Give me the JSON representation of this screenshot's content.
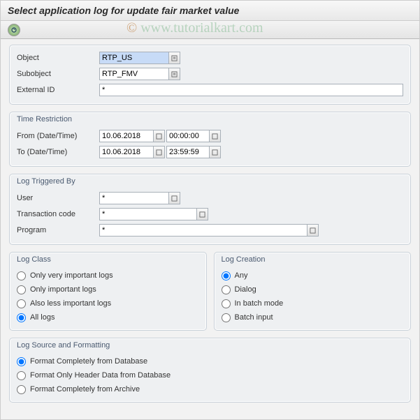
{
  "title": "Select application log for update fair market value",
  "watermark": "www.tutorialkart.com",
  "selection": {
    "object_label": "Object",
    "object_value": "RTP_US",
    "subobject_label": "Subobject",
    "subobject_value": "RTP_FMV",
    "external_id_label": "External ID",
    "external_id_value": "*"
  },
  "time_restriction": {
    "title": "Time Restriction",
    "from_label": "From (Date/Time)",
    "from_date": "10.06.2018",
    "from_time": "00:00:00",
    "to_label": "To (Date/Time)",
    "to_date": "10.06.2018",
    "to_time": "23:59:59"
  },
  "log_triggered": {
    "title": "Log Triggered By",
    "user_label": "User",
    "user_value": "*",
    "tcode_label": "Transaction code",
    "tcode_value": "*",
    "program_label": "Program",
    "program_value": "*"
  },
  "log_class": {
    "title": "Log Class",
    "options": {
      "very_important": "Only very important logs",
      "important": "Only important logs",
      "less_important": "Also less important logs",
      "all": "All logs"
    },
    "selected": "all"
  },
  "log_creation": {
    "title": "Log Creation",
    "options": {
      "any": "Any",
      "dialog": "Dialog",
      "batch": "In batch mode",
      "batch_input": "Batch input"
    },
    "selected": "any"
  },
  "log_source": {
    "title": "Log Source and Formatting",
    "options": {
      "db_full": "Format Completely from Database",
      "db_header": "Format Only Header Data from Database",
      "archive": "Format Completely from Archive"
    },
    "selected": "db_full"
  }
}
